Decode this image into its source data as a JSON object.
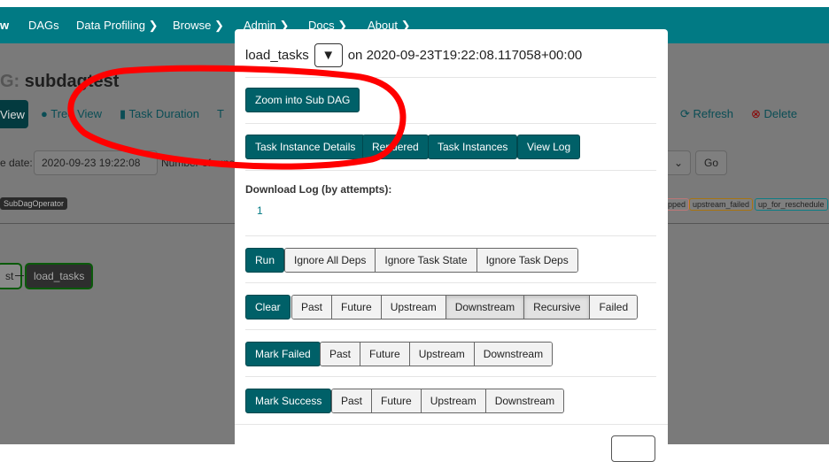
{
  "nav": {
    "brand_fragment": "w",
    "items": [
      "DAGs",
      "Data Profiling ❯",
      "Browse ❯",
      "Admin ❯",
      "Docs ❯",
      "About ❯"
    ]
  },
  "page": {
    "title_prefix": "G:",
    "title": "subdagtest",
    "tabs": {
      "graph": "View",
      "tree": "Tree View",
      "duration": "Task Duration",
      "tries": "T",
      "refresh": "Refresh",
      "delete": "Delete"
    },
    "base_date_label": "e date:",
    "base_date": "2020-09-23 19:22:08",
    "runs_label": "Number of runs:",
    "go": "Go",
    "operator_badge": "SubDagOperator",
    "states": [
      "pped",
      "upstream_failed",
      "up_for_reschedule"
    ],
    "nodes": [
      "st",
      "load_tasks"
    ]
  },
  "modal": {
    "task": "load_tasks",
    "on_text": "on 2020-09-23T19:22:08.117058+00:00",
    "zoom_subdag": "Zoom into Sub DAG",
    "links": [
      "Task Instance Details",
      "Rendered",
      "Task Instances",
      "View Log"
    ],
    "download_label": "Download Log (by attempts):",
    "attempts": [
      "1"
    ],
    "run": {
      "label": "Run",
      "options": [
        "Ignore All Deps",
        "Ignore Task State",
        "Ignore Task Deps"
      ]
    },
    "clear": {
      "label": "Clear",
      "options": [
        "Past",
        "Future",
        "Upstream",
        "Downstream",
        "Recursive",
        "Failed"
      ]
    },
    "mark_failed": {
      "label": "Mark Failed",
      "options": [
        "Past",
        "Future",
        "Upstream",
        "Downstream"
      ]
    },
    "mark_success": {
      "label": "Mark Success",
      "options": [
        "Past",
        "Future",
        "Upstream",
        "Downstream"
      ]
    }
  },
  "colors": {
    "teal_nav": "#017a84",
    "button": "#006068",
    "annotation": "#ff0000"
  }
}
